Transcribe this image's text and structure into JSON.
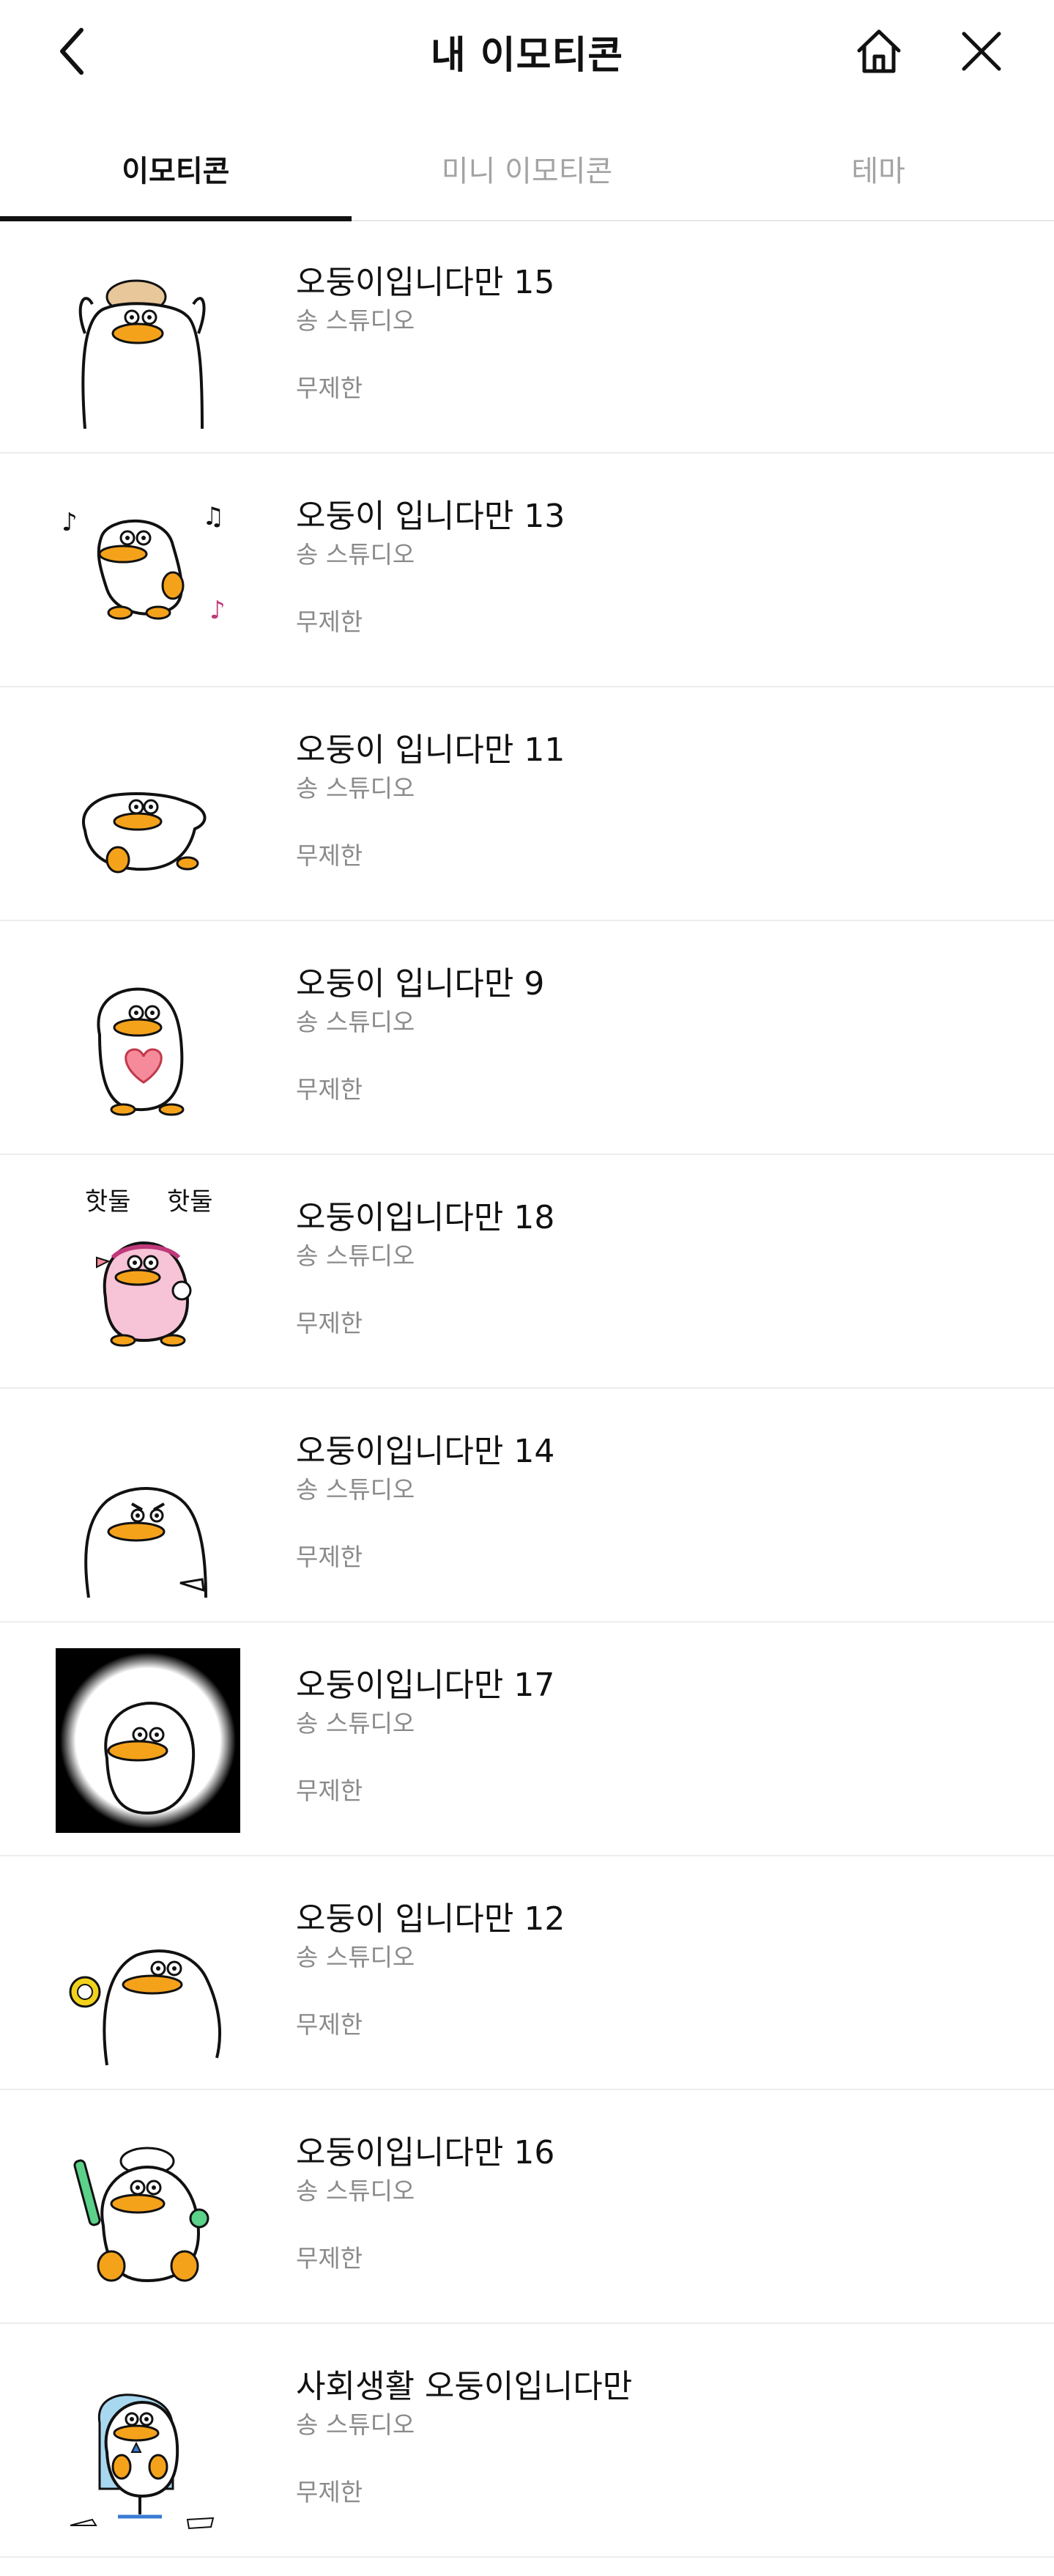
{
  "header": {
    "title": "내 이모티콘",
    "back_icon": "chevron-left-icon",
    "home_icon": "home-icon",
    "close_icon": "close-icon"
  },
  "tabs": [
    {
      "label": "이모티콘",
      "active": true
    },
    {
      "label": "미니 이모티콘",
      "active": false
    },
    {
      "label": "테마",
      "active": false
    }
  ],
  "emoticons": [
    {
      "title": "오둥이입니다만 15",
      "maker": "송 스튜디오",
      "period": "무제한"
    },
    {
      "title": "오둥이 입니다만 13",
      "maker": "송 스튜디오",
      "period": "무제한"
    },
    {
      "title": "오둥이 입니다만 11",
      "maker": "송 스튜디오",
      "period": "무제한"
    },
    {
      "title": "오둥이 입니다만 9",
      "maker": "송 스튜디오",
      "period": "무제한"
    },
    {
      "title": "오둥이입니다만 18",
      "maker": "송 스튜디오",
      "period": "무제한"
    },
    {
      "title": "오둥이입니다만 14",
      "maker": "송 스튜디오",
      "period": "무제한"
    },
    {
      "title": "오둥이입니다만 17",
      "maker": "송 스튜디오",
      "period": "무제한"
    },
    {
      "title": "오둥이 입니다만 12",
      "maker": "송 스튜디오",
      "period": "무제한"
    },
    {
      "title": "오둥이입니다만 16",
      "maker": "송 스튜디오",
      "period": "무제한"
    },
    {
      "title": "사회생활 오둥이입니다만",
      "maker": "송 스튜디오",
      "period": "무제한"
    }
  ],
  "thumb_texts": {
    "row5_left": "핫둘",
    "row5_right": "핫둘"
  },
  "colors": {
    "beak": "#f5a21b",
    "pink_body": "#f7c3d6",
    "heart": "#f58a9a",
    "divider": "#ededed",
    "muted_text": "#8a8a8a"
  }
}
